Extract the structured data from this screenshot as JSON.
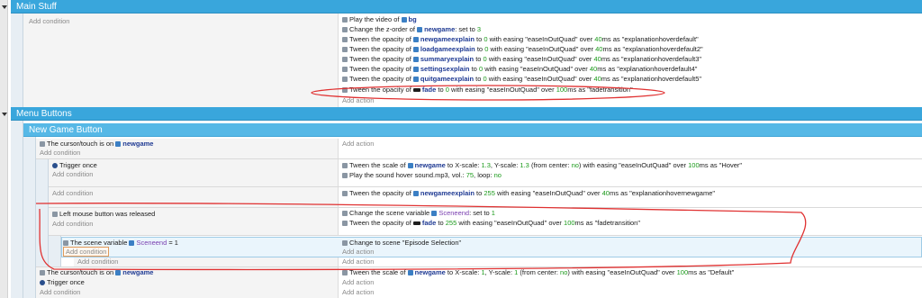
{
  "groups": {
    "main_stuff": "Main Stuff",
    "menu_buttons": "Menu Buttons",
    "new_game_button": "New Game Button"
  },
  "labels": {
    "add_condition": "Add condition",
    "add_action": "Add action"
  },
  "main_stuff_actions": {
    "a1_pre": "Play the video of",
    "a1_obj": "bg",
    "a2_pre": "Change the z-order of",
    "a2_obj": "newgame",
    "a2_mid": ": set to",
    "a2_num": "3",
    "a3_pre": "Tween the opacity of",
    "a3_obj": "newgameexplain",
    "a3_to": "to",
    "a3_num": "0",
    "a3_ease": "with easing \"easeInOutQuad\" over",
    "a3_ms": "40",
    "a3_as": "ms as \"explanationhoverdefault\"",
    "a4_obj": "loadgameexplain",
    "a4_as": "ms as \"explanationhoverdefault2\"",
    "a5_obj": "summaryexplain",
    "a5_as": "ms as \"explanationhoverdefault3\"",
    "a6_obj": "settingsexplain",
    "a6_as": "ms as \"explanationhoverdefault4\"",
    "a7_obj": "quitgameexplain",
    "a7_as": "ms as \"explanationhoverdefault5\"",
    "a8_obj": "fade",
    "a8_ms": "100",
    "a8_as": "ms as \"fadetransition\""
  },
  "events": {
    "touch_on": "The cursor/touch is on",
    "touch_obj": "newgame",
    "trigger_once": "Trigger once",
    "left_release": "Left mouse button was released",
    "scene_var_cond_pre": "The scene variable",
    "scene_var_name": "Sceneend",
    "scene_var_cond_val": "= 1"
  },
  "ev_actions": {
    "scale_pre": "Tween the scale of",
    "scale_obj": "newgame",
    "scale_x": "to X-scale:",
    "scale_x_val": "1.3",
    "scale_y": ", Y-scale:",
    "scale_y_val": "1.3",
    "scale_center": "(from center:",
    "scale_center_val": "no",
    "scale_ease": ") with easing \"easeInOutQuad\" over",
    "scale_ms": "100",
    "scale_as": "ms as \"Hover\"",
    "sound_pre": "Play the sound",
    "sound_file": "hover sound.mp3",
    "sound_vol": ", vol.:",
    "sound_vol_val": "75",
    "sound_loop": ", loop:",
    "sound_loop_val": "no",
    "ng_obj": "newgameexplain",
    "ng_num": "255",
    "ng_as": "ms as \"explanationhovernewgame\"",
    "chvar_pre": "Change the scene variable",
    "chvar_mid": ": set to",
    "chvar_val": "1",
    "fade_num": "255",
    "change_scene": "Change to scene \"Episode Selection\"",
    "scale2_x_val": "1",
    "scale2_y_val": "1",
    "scale2_as": "ms as \"Default\""
  },
  "colors": {
    "group_blue": "#39a6dc",
    "annotation_red": "#e03131"
  }
}
